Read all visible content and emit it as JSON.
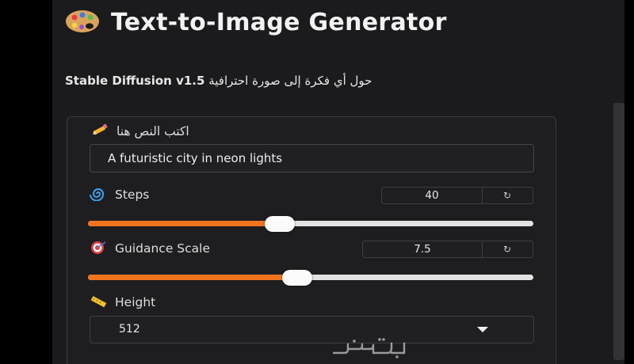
{
  "app": {
    "title": "Text-to-Image Generator",
    "title_icon": "palette-icon",
    "subtitle_model": "Stable Diffusion v1.5",
    "subtitle_text": "حول أي فكرة إلى صورة احترافية"
  },
  "form": {
    "prompt": {
      "label": "اكتب النص هنا",
      "icon": "pencil-icon",
      "value": "A futuristic city in neon lights"
    },
    "steps": {
      "label": "Steps",
      "icon": "cyclone-icon",
      "value": "40",
      "reset_label": "↻",
      "fraction": 0.43
    },
    "guidance": {
      "label": "Guidance Scale",
      "icon": "target-icon",
      "value": "7.5",
      "reset_label": "↻",
      "fraction": 0.47
    },
    "height": {
      "label": "Height",
      "icon": "ruler-icon",
      "value": "512"
    }
  },
  "colors": {
    "accent": "#f0731e",
    "background": "#1b1b1d",
    "panel_border": "#3b3b3f"
  },
  "watermark": "logo-watermark"
}
